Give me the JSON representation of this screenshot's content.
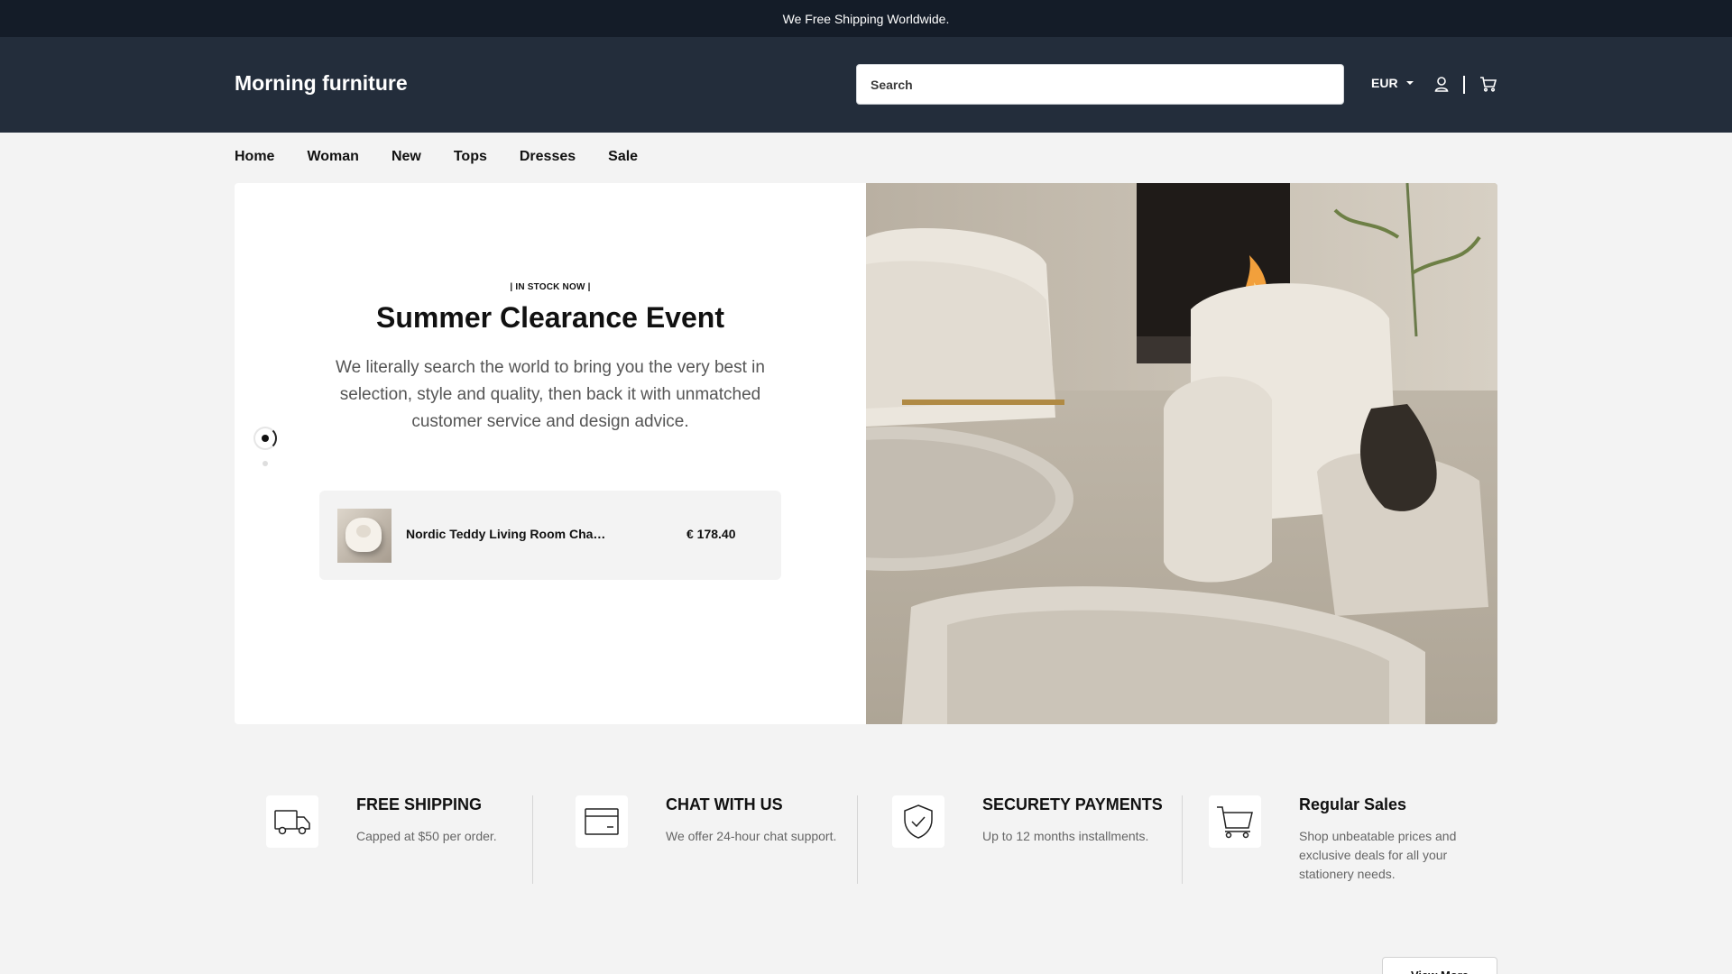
{
  "announcement": "We Free Shipping Worldwide.",
  "header": {
    "logo": "Morning furniture",
    "search_placeholder": "Search",
    "currency": "EUR"
  },
  "nav": [
    "Home",
    "Woman",
    "New",
    "Tops",
    "Dresses",
    "Sale"
  ],
  "hero": {
    "eyebrow": "| IN STOCK NOW |",
    "title": "Summer Clearance Event",
    "description": "We literally search the world to bring you the very best in selection, style and quality, then back it with unmatched customer service and design advice.",
    "product": {
      "name": "Nordic Teddy Living Room Chair Wool...",
      "price": "€ 178.40"
    }
  },
  "features": [
    {
      "title": "FREE SHIPPING",
      "subtitle": "Capped at $50 per order.",
      "icon": "truck-icon"
    },
    {
      "title": "CHAT WITH US",
      "subtitle": "We offer 24-hour chat support.",
      "icon": "card-icon"
    },
    {
      "title": "SECURETY PAYMENTS",
      "subtitle": "Up to 12 months installments.",
      "icon": "shield-check-icon"
    },
    {
      "title": "Regular Sales",
      "subtitle": "Shop unbeatable prices and exclusive deals for all your stationery needs.",
      "icon": "cart-icon"
    }
  ],
  "view_more": "View More",
  "colors": {
    "topbar": "#141c28",
    "header": "#232d3b",
    "page_background": "#f3f3f3"
  }
}
